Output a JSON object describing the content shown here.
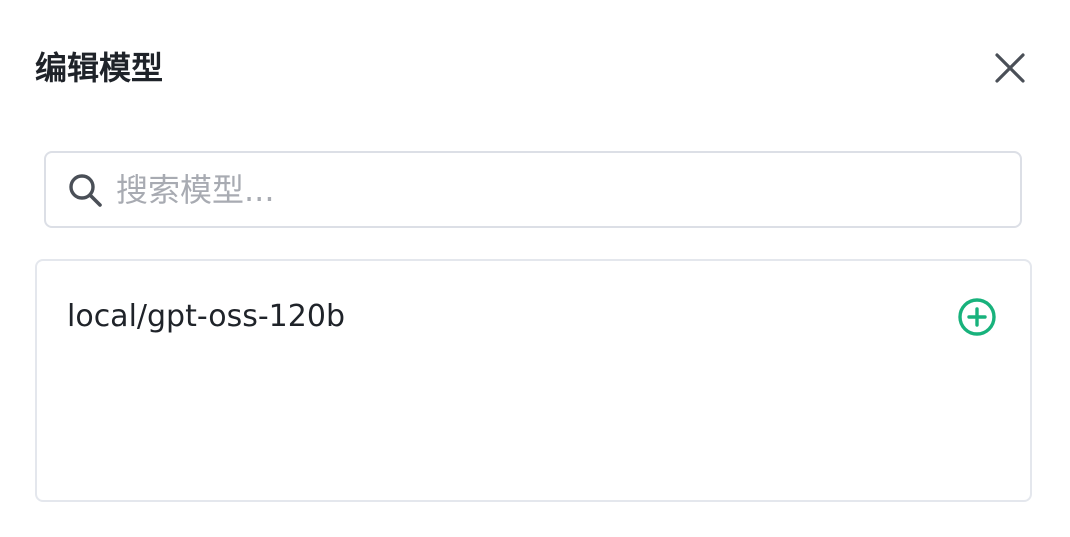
{
  "dialog": {
    "title": "编辑模型",
    "close_icon": "close-icon"
  },
  "search": {
    "placeholder": "搜索模型...",
    "value": "",
    "icon": "search-icon"
  },
  "models": {
    "items": [
      {
        "name": "local/gpt-oss-120b",
        "action_icon": "add-circle-icon"
      }
    ]
  },
  "colors": {
    "title": "#1f2329",
    "placeholder": "#a8abb2",
    "border": "#dcdfe6",
    "accent": "#18b27c",
    "icon": "#4a4f57"
  }
}
